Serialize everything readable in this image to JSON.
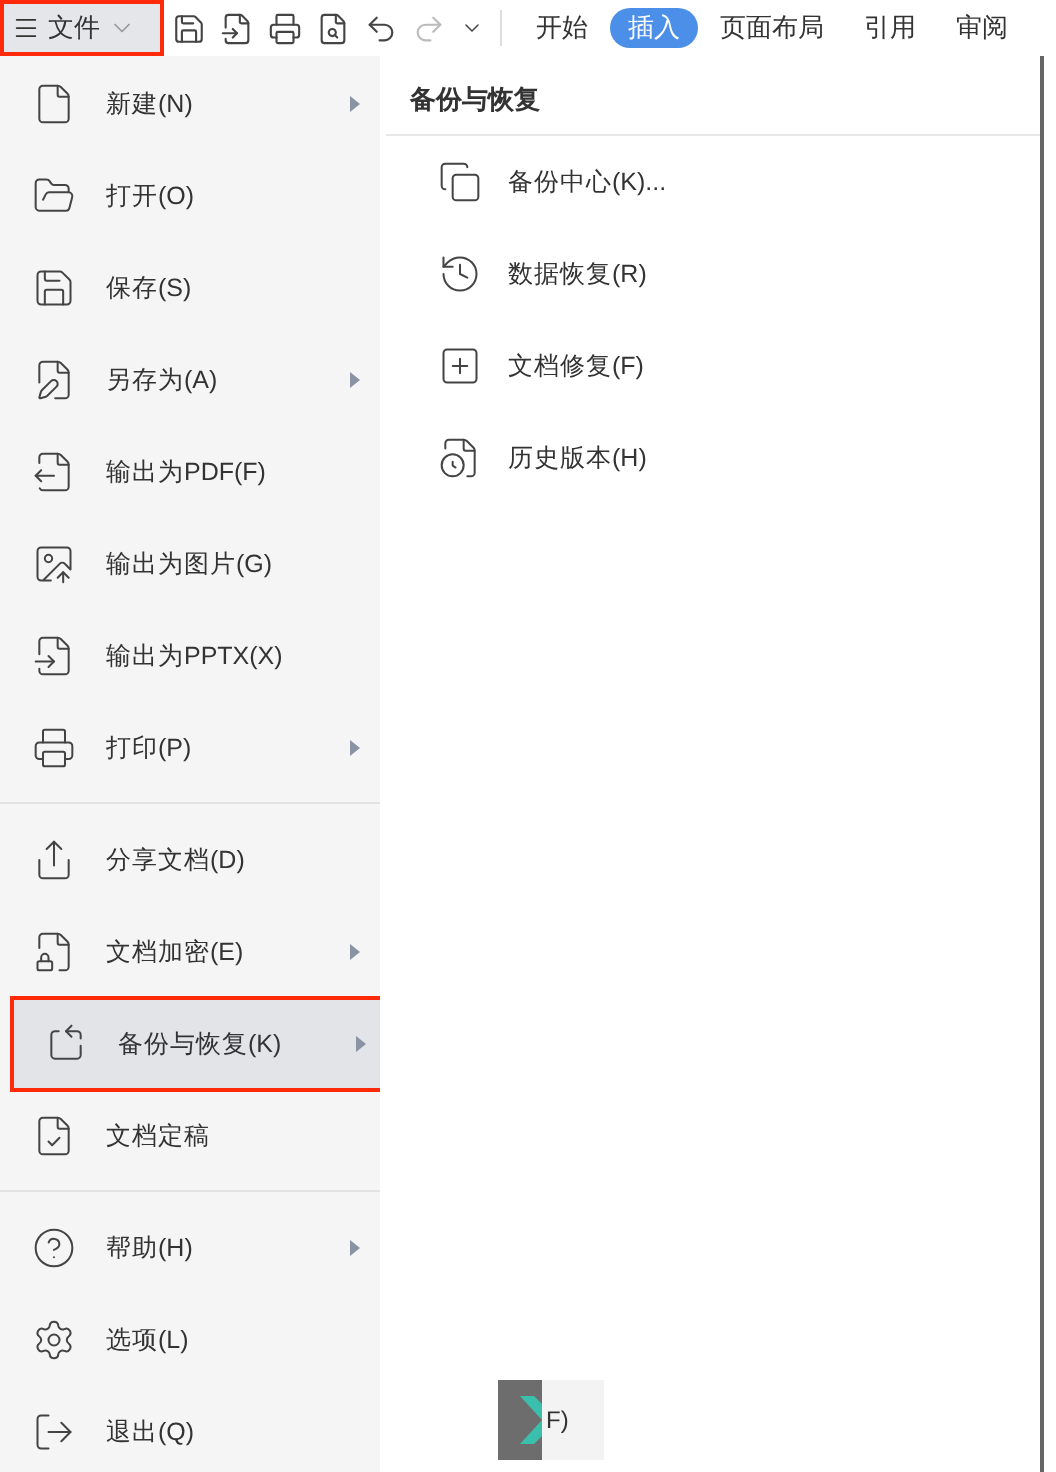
{
  "file_button": {
    "label": "文件",
    "highlighted": true
  },
  "ribbon_tabs": [
    {
      "label": "开始",
      "selected": false
    },
    {
      "label": "插入",
      "selected": true
    },
    {
      "label": "页面布局",
      "selected": false
    },
    {
      "label": "引用",
      "selected": false
    },
    {
      "label": "审阅",
      "selected": false
    }
  ],
  "menu": {
    "groups": [
      [
        {
          "label": "新建(N)",
          "submenu": true,
          "selected": false,
          "highlighted": false
        },
        {
          "label": "打开(O)",
          "submenu": false,
          "selected": false,
          "highlighted": false
        },
        {
          "label": "保存(S)",
          "submenu": false,
          "selected": false,
          "highlighted": false
        },
        {
          "label": "另存为(A)",
          "submenu": true,
          "selected": false,
          "highlighted": false
        },
        {
          "label": "输出为PDF(F)",
          "submenu": false,
          "selected": false,
          "highlighted": false
        },
        {
          "label": "输出为图片(G)",
          "submenu": false,
          "selected": false,
          "highlighted": false
        },
        {
          "label": "输出为PPTX(X)",
          "submenu": false,
          "selected": false,
          "highlighted": false
        },
        {
          "label": "打印(P)",
          "submenu": true,
          "selected": false,
          "highlighted": false
        }
      ],
      [
        {
          "label": "分享文档(D)",
          "submenu": false,
          "selected": false,
          "highlighted": false
        },
        {
          "label": "文档加密(E)",
          "submenu": true,
          "selected": false,
          "highlighted": false
        },
        {
          "label": "备份与恢复(K)",
          "submenu": true,
          "selected": true,
          "highlighted": true
        },
        {
          "label": "文档定稿",
          "submenu": false,
          "selected": false,
          "highlighted": false
        }
      ],
      [
        {
          "label": "帮助(H)",
          "submenu": true,
          "selected": false,
          "highlighted": false
        },
        {
          "label": "选项(L)",
          "submenu": false,
          "selected": false,
          "highlighted": false
        },
        {
          "label": "退出(Q)",
          "submenu": false,
          "selected": false,
          "highlighted": false
        }
      ]
    ]
  },
  "submenu": {
    "title": "备份与恢复",
    "items": [
      "备份中心(K)...",
      "数据恢复(R)",
      "文档修复(F)",
      "历史版本(H)"
    ]
  },
  "background_fragment": "F)"
}
